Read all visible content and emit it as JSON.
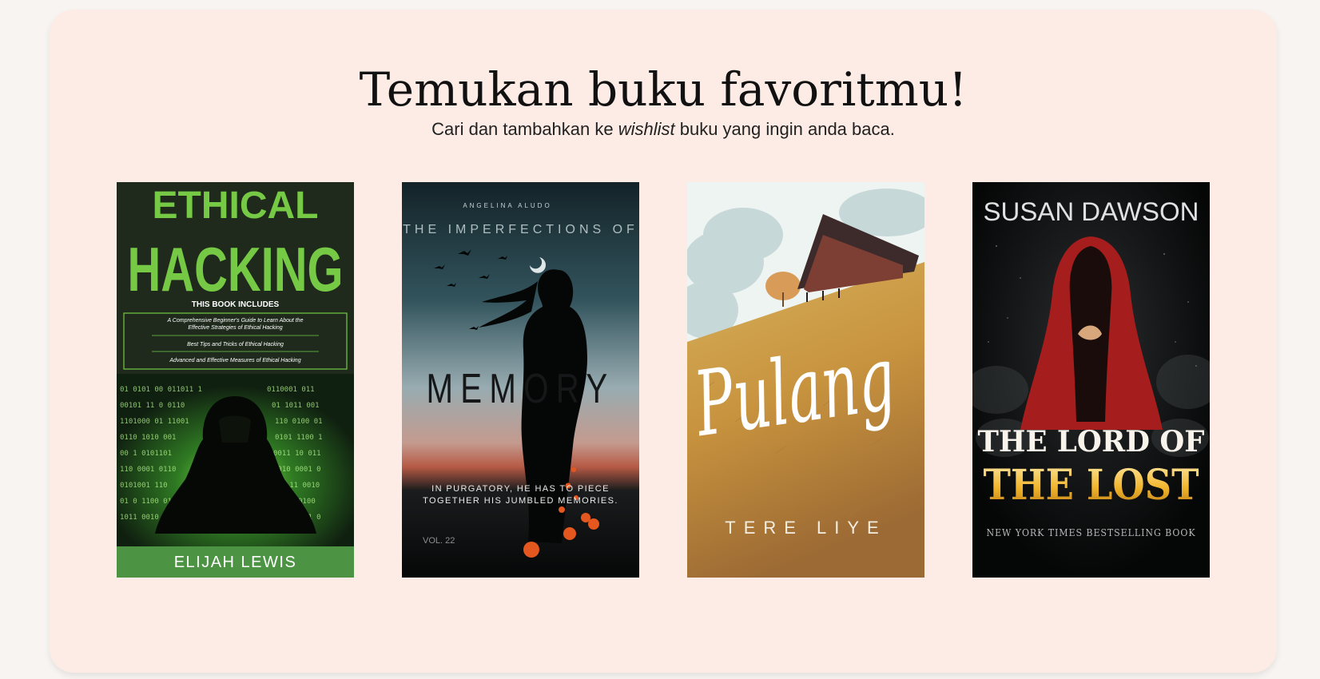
{
  "hero": {
    "title": "Temukan buku favoritmu!",
    "subtitle_before": "Cari dan tambahkan ke ",
    "subtitle_em": "wishlist",
    "subtitle_after": " buku yang ingin anda baca."
  },
  "books": [
    {
      "title_line1": "ETHICAL",
      "title_line2": "HACKING",
      "includes_heading": "THIS BOOK INCLUDES",
      "includes": [
        "A Comprehensive Beginner's Guide to Learn About the",
        "Effective Strategies of Ethical Hacking",
        "Best Tips and Tricks of Ethical Hacking",
        "Advanced and Effective Measures of Ethical Hacking"
      ],
      "author": "ELIJAH LEWIS"
    },
    {
      "author": "ANGELINA ALUDO",
      "kicker": "THE IMPERFECTIONS OF",
      "title": "MEMORY",
      "tagline_line1": "IN PURGATORY, HE HAS TO PIECE",
      "tagline_line2": "TOGETHER HIS JUMBLED MEMORIES.",
      "volume": "VOL. 22"
    },
    {
      "title": "Pulang",
      "author": "TERE LIYE"
    },
    {
      "author": "SUSAN DAWSON",
      "title_line1": "THE LORD OF",
      "title_line2": "THE LOST",
      "tagline": "NEW YORK TIMES BESTSELLING BOOK"
    }
  ]
}
